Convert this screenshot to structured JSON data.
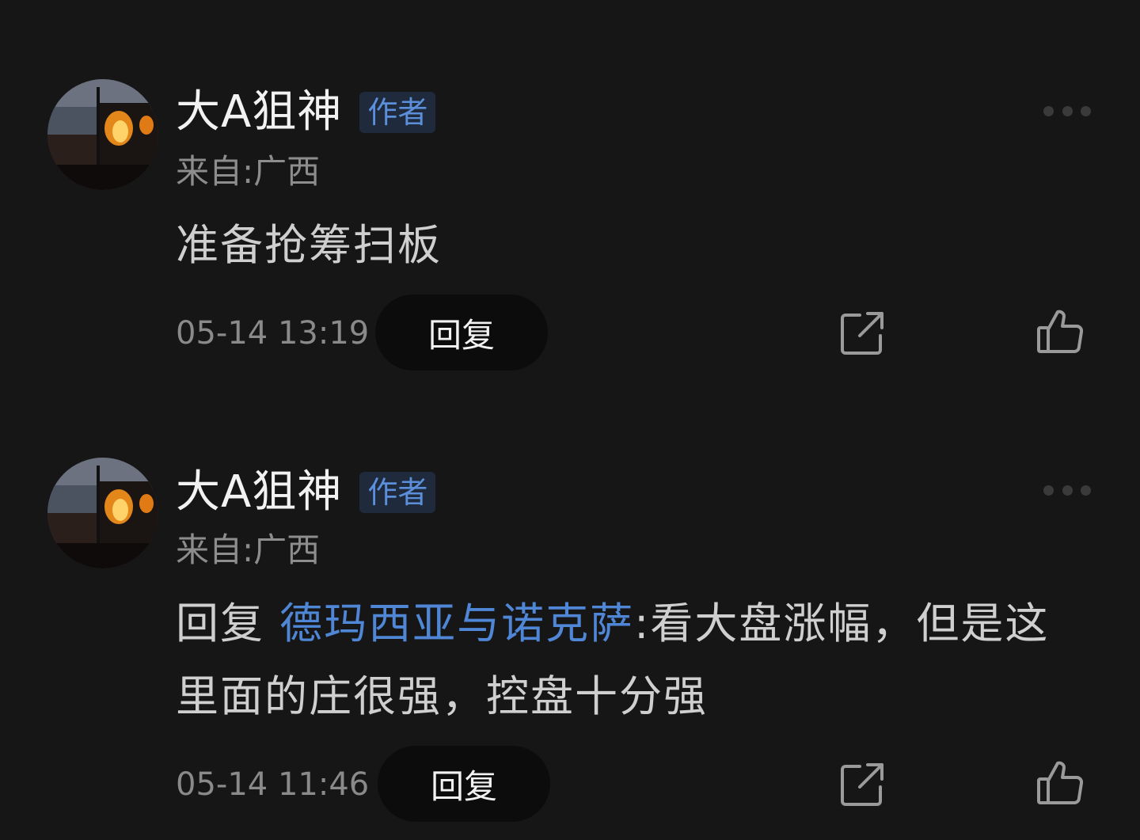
{
  "comments": [
    {
      "username": "大A狙神",
      "badge": "作者",
      "location": "来自:广西",
      "reply_prefix": "",
      "mention": "",
      "separator": "",
      "content": "准备抢筹扫板",
      "time": "05-14 13:19",
      "reply_label": "回复",
      "icons": {
        "more": "more-icon",
        "share": "share-icon",
        "like": "thumbs-up-icon"
      }
    },
    {
      "username": "大A狙神",
      "badge": "作者",
      "location": "来自:广西",
      "reply_prefix": "回复 ",
      "mention": "德玛西亚与诺克萨",
      "separator": ":",
      "content": "看大盘涨幅，但是这里面的庄很强，控盘十分强",
      "time": "05-14 11:46",
      "reply_label": "回复",
      "icons": {
        "more": "more-icon",
        "share": "share-icon",
        "like": "thumbs-up-icon"
      }
    }
  ],
  "colors": {
    "background": "#161616",
    "badge_text": "#5b8fd9",
    "badge_bg": "#1f2a3c",
    "mention": "#4f86d6",
    "reply_button_bg": "#0c0c0c"
  }
}
